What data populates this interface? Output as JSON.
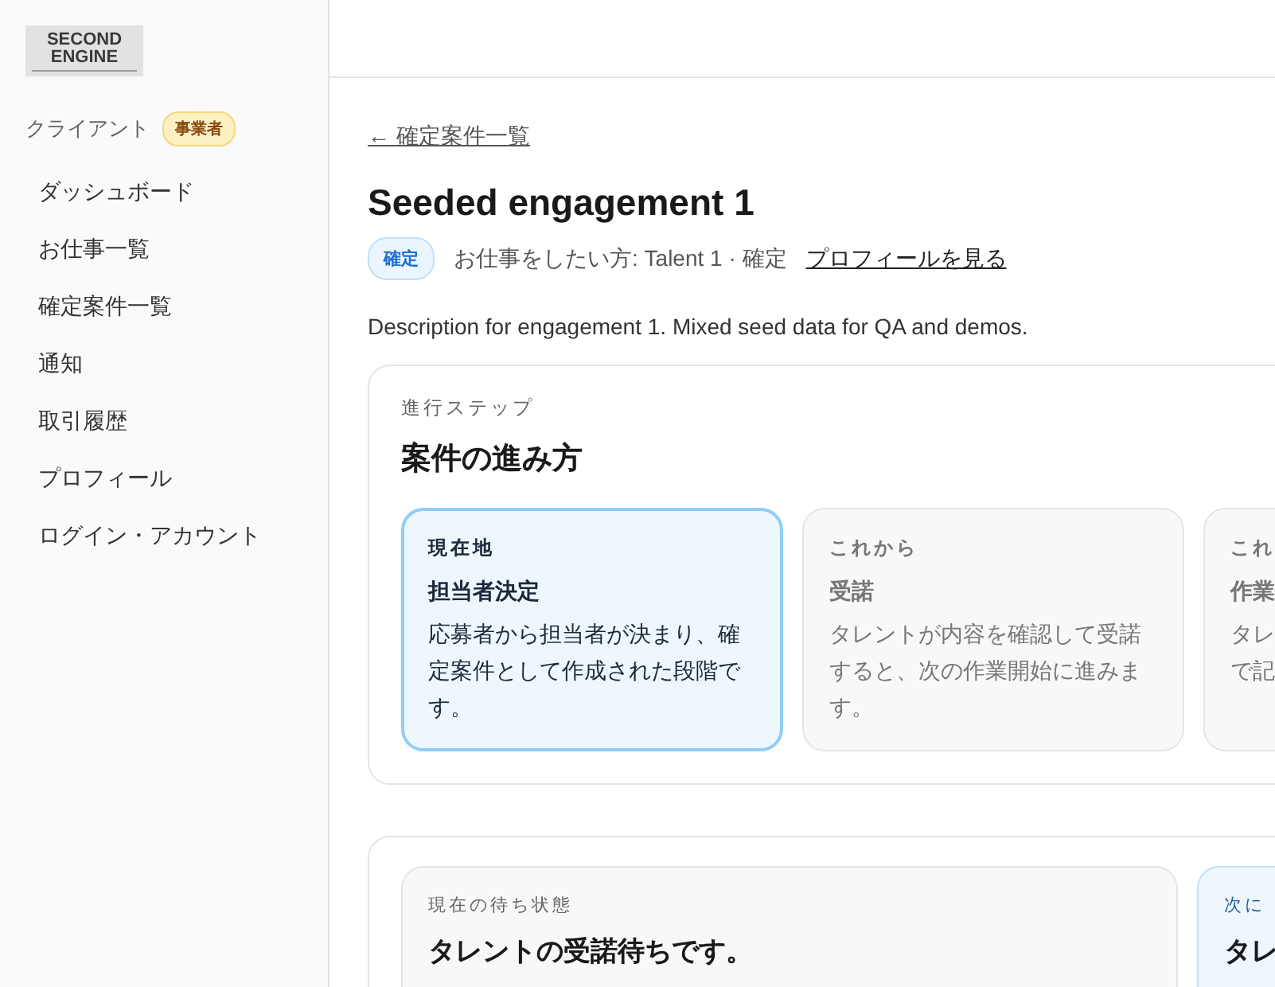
{
  "logo": {
    "line_1": "SECOND",
    "line_2": "ENGINE"
  },
  "sidebar": {
    "role": "クライアント",
    "role_badge": "事業者",
    "items": [
      {
        "label": "ダッシュボード",
        "selected": false
      },
      {
        "label": "お仕事一覧",
        "selected": false
      },
      {
        "label": "確定案件一覧",
        "selected": false
      },
      {
        "label": "通知",
        "selected": false
      },
      {
        "label": "取引履歴",
        "selected": false
      },
      {
        "label": "プロフィール",
        "selected": false
      },
      {
        "label": "ログイン・アカウント",
        "selected": false
      }
    ]
  },
  "back_link": "← 確定案件一覧",
  "title": "Seeded engagement 1",
  "status_badge": "確定",
  "meta": "お仕事をしたい方: Talent 1 · 確定",
  "profile_link": "プロフィールを見る",
  "description": "Description for engagement 1. Mixed seed data for QA and demos.",
  "steps_section": {
    "eyebrow": "進行ステップ",
    "heading": "案件の進み方",
    "steps": [
      {
        "label": "現在地",
        "title": "担当者決定",
        "lines": [
          "応募者から担当者が決まり、確",
          "定案件として作成された段階で",
          "す。"
        ],
        "current": true
      },
      {
        "label": "これから",
        "title": "受諾",
        "lines": [
          "タレントが内容を確認して受諾",
          "すると、次の作業開始に進みま",
          "す。"
        ],
        "current": false
      },
      {
        "label": "これ",
        "title": "作業",
        "lines": [
          "タレ",
          "で記"
        ],
        "current": false
      }
    ]
  },
  "status_section": {
    "cards": [
      {
        "label": "現在の待ち状態",
        "title": "タレントの受諾待ちです。",
        "highlight": false
      },
      {
        "label": "次に",
        "title": "タレ",
        "highlight": true
      }
    ]
  }
}
